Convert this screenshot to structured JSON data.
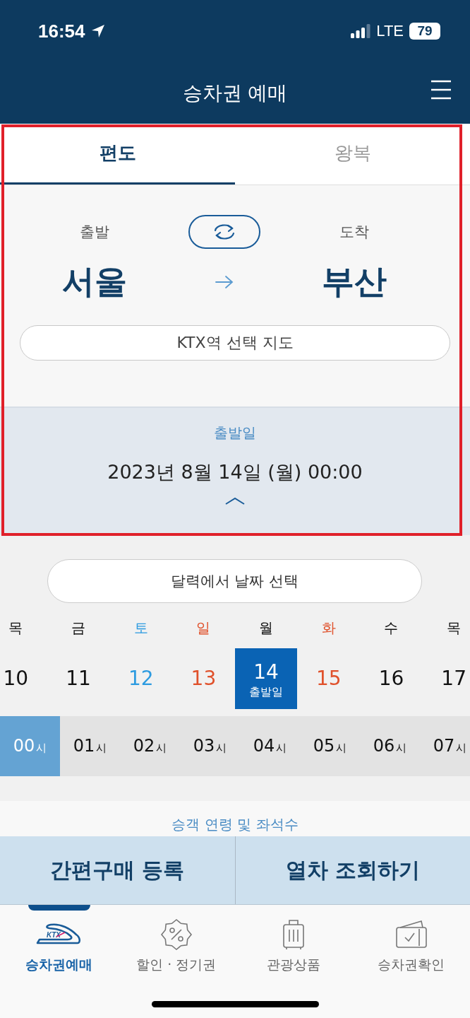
{
  "status_bar": {
    "time": "16:54",
    "network": "LTE",
    "battery": "79"
  },
  "header": {
    "title": "승차권 예매"
  },
  "tabs": [
    {
      "label": "편도",
      "selected": true
    },
    {
      "label": "왕복",
      "selected": false
    }
  ],
  "route": {
    "departure_label": "출발",
    "arrival_label": "도착",
    "departure": "서울",
    "arrival": "부산",
    "map_button": "KTX역 선택 지도"
  },
  "date": {
    "label": "출발일",
    "value": "2023년 8월 14일 (월) 00:00"
  },
  "calendar_button": "달력에서 날짜 선택",
  "days": [
    {
      "weekday": "목",
      "date": "10",
      "kind": "weekday",
      "selected": false
    },
    {
      "weekday": "금",
      "date": "11",
      "kind": "weekday",
      "selected": false
    },
    {
      "weekday": "토",
      "date": "12",
      "kind": "saturday",
      "selected": false
    },
    {
      "weekday": "일",
      "date": "13",
      "kind": "holiday",
      "selected": false
    },
    {
      "weekday": "월",
      "date": "14",
      "kind": "weekday",
      "selected": true,
      "caption": "출발일"
    },
    {
      "weekday": "화",
      "date": "15",
      "kind": "holiday",
      "selected": false
    },
    {
      "weekday": "수",
      "date": "16",
      "kind": "weekday",
      "selected": false
    },
    {
      "weekday": "목",
      "date": "17",
      "kind": "weekday",
      "selected": false
    }
  ],
  "hours": [
    {
      "hour": "00",
      "unit": "시",
      "selected": true
    },
    {
      "hour": "01",
      "unit": "시",
      "selected": false
    },
    {
      "hour": "02",
      "unit": "시",
      "selected": false
    },
    {
      "hour": "03",
      "unit": "시",
      "selected": false
    },
    {
      "hour": "04",
      "unit": "시",
      "selected": false
    },
    {
      "hour": "05",
      "unit": "시",
      "selected": false
    },
    {
      "hour": "06",
      "unit": "시",
      "selected": false
    },
    {
      "hour": "07",
      "unit": "시",
      "selected": false
    }
  ],
  "passenger_section": {
    "title": "승객 연령 및 좌석수"
  },
  "actions": [
    "간편구매 등록",
    "열차 조회하기"
  ],
  "bottom_nav": [
    {
      "label": "승차권예매",
      "kind": "train",
      "icon_text": "KTX",
      "selected": true
    },
    {
      "label": "할인 · 정기권",
      "kind": "discount",
      "selected": false
    },
    {
      "label": "관광상품",
      "kind": "suitcase",
      "selected": false
    },
    {
      "label": "승차권확인",
      "kind": "ticket",
      "selected": false
    }
  ]
}
